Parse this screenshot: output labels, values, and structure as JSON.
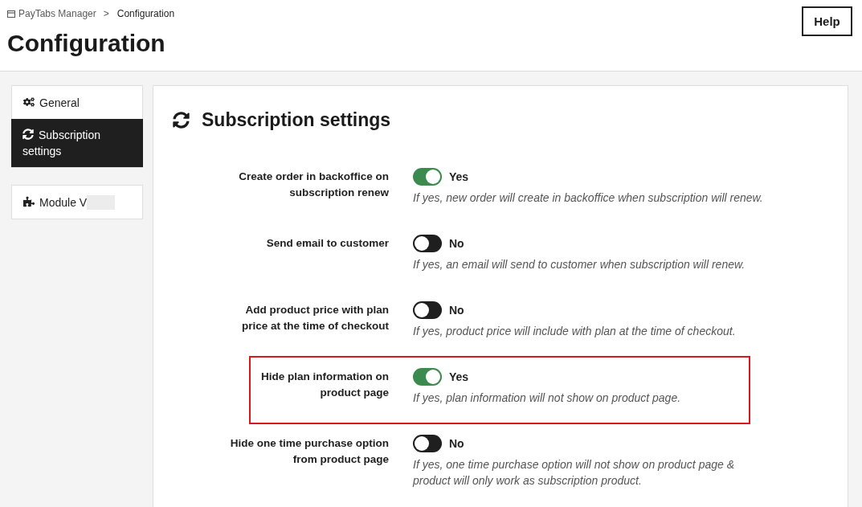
{
  "breadcrumb": {
    "items": [
      {
        "label": "PayTabs Manager",
        "current": false
      },
      {
        "label": "Configuration",
        "current": true
      }
    ],
    "separator": ">"
  },
  "page_title": "Configuration",
  "help_button": "Help",
  "sidebar": {
    "groups": [
      {
        "items": [
          {
            "label": "General",
            "selected": false,
            "redacted": false
          },
          {
            "label": "Subscription settings",
            "selected": true,
            "redacted": false
          }
        ]
      },
      {
        "items": [
          {
            "label": "Module V",
            "selected": false,
            "redacted": true
          }
        ]
      }
    ]
  },
  "section": {
    "title": "Subscription settings",
    "settings": [
      {
        "label": "Create order in backoffice on subscription renew",
        "on": true,
        "state_text": "Yes",
        "help": "If yes, new order will create in backoffice when subscription will renew.",
        "highlighted": false
      },
      {
        "label": "Send email to customer",
        "on": false,
        "state_text": "No",
        "help": "If yes, an email will send to customer when subscription will renew.",
        "highlighted": false
      },
      {
        "label": "Add product price with plan price at the time of checkout",
        "on": false,
        "state_text": "No",
        "help": "If yes, product price will include with plan at the time of checkout.",
        "highlighted": false
      },
      {
        "label": "Hide plan information on product page",
        "on": true,
        "state_text": "Yes",
        "help": "If yes, plan information will not show on product page.",
        "highlighted": true
      },
      {
        "label": "Hide one time purchase option from product page",
        "on": false,
        "state_text": "No",
        "help": "If yes, one time purchase option will not show on product page & product will only work as subscription product.",
        "highlighted": false
      }
    ]
  }
}
